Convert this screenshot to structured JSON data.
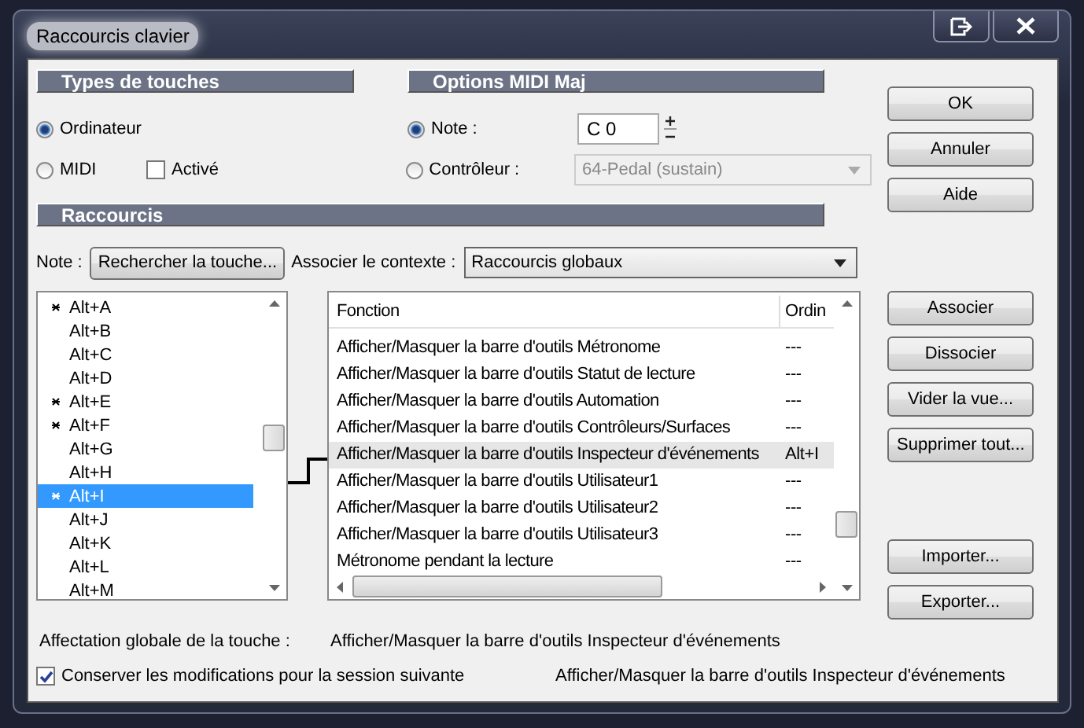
{
  "window": {
    "title": "Raccourcis clavier"
  },
  "key_types": {
    "header": "Types de touches",
    "options": [
      {
        "label": "Ordinateur",
        "selected": true
      },
      {
        "label": "MIDI",
        "selected": false
      }
    ],
    "active_checkbox": {
      "label": "Activé",
      "checked": false
    }
  },
  "midi_options": {
    "header": "Options MIDI Maj",
    "note": {
      "label": "Note :",
      "selected": true,
      "value": "C 0"
    },
    "controller": {
      "label": "Contrôleur :",
      "selected": false,
      "value": "64-Pedal (sustain)",
      "disabled": true
    }
  },
  "shortcuts": {
    "header": "Raccourcis",
    "note_label": "Note :",
    "find_button": "Rechercher la touche...",
    "context_label": "Associer le contexte :",
    "context_value": "Raccourcis globaux",
    "keys": [
      {
        "label": "Alt+A",
        "assigned": true,
        "selected": false
      },
      {
        "label": "Alt+B",
        "assigned": false,
        "selected": false
      },
      {
        "label": "Alt+C",
        "assigned": false,
        "selected": false
      },
      {
        "label": "Alt+D",
        "assigned": false,
        "selected": false
      },
      {
        "label": "Alt+E",
        "assigned": true,
        "selected": false
      },
      {
        "label": "Alt+F",
        "assigned": true,
        "selected": false
      },
      {
        "label": "Alt+G",
        "assigned": false,
        "selected": false
      },
      {
        "label": "Alt+H",
        "assigned": false,
        "selected": false
      },
      {
        "label": "Alt+I",
        "assigned": true,
        "selected": true
      },
      {
        "label": "Alt+J",
        "assigned": false,
        "selected": false
      },
      {
        "label": "Alt+K",
        "assigned": false,
        "selected": false
      },
      {
        "label": "Alt+L",
        "assigned": false,
        "selected": false
      },
      {
        "label": "Alt+M",
        "assigned": false,
        "selected": false
      }
    ],
    "table": {
      "columns": [
        "Fonction",
        "Ordin"
      ],
      "rows": [
        {
          "cells": [
            "Afficher/Masquer la barre d'outils Métronome",
            "---"
          ],
          "selected": false
        },
        {
          "cells": [
            "Afficher/Masquer la barre d'outils Statut de lecture",
            "---"
          ],
          "selected": false
        },
        {
          "cells": [
            "Afficher/Masquer la barre d'outils Automation",
            "---"
          ],
          "selected": false
        },
        {
          "cells": [
            "Afficher/Masquer la barre d'outils Contrôleurs/Surfaces",
            "---"
          ],
          "selected": false
        },
        {
          "cells": [
            "Afficher/Masquer la barre d'outils Inspecteur d'événements",
            "Alt+I"
          ],
          "selected": true
        },
        {
          "cells": [
            "Afficher/Masquer la barre d'outils Utilisateur1",
            "---"
          ],
          "selected": false
        },
        {
          "cells": [
            "Afficher/Masquer la barre d'outils Utilisateur2",
            "---"
          ],
          "selected": false
        },
        {
          "cells": [
            "Afficher/Masquer la barre d'outils Utilisateur3",
            "---"
          ],
          "selected": false
        },
        {
          "cells": [
            "Métronome pendant la lecture",
            "---"
          ],
          "selected": false
        }
      ]
    }
  },
  "global_assignment": {
    "label": "Affectation globale de la touche :",
    "value": "Afficher/Masquer la barre d'outils Inspecteur d'événements"
  },
  "keep_changes": {
    "label": "Conserver les modifications pour la session suivante",
    "checked": true
  },
  "status_text": "Afficher/Masquer la barre d'outils Inspecteur d'événements",
  "buttons_top": [
    "OK",
    "Annuler",
    "Aide"
  ],
  "buttons_middle": [
    "Associer",
    "Dissocier",
    "Vider la vue...",
    "Supprimer tout..."
  ],
  "buttons_bottom": [
    "Importer...",
    "Exporter..."
  ]
}
